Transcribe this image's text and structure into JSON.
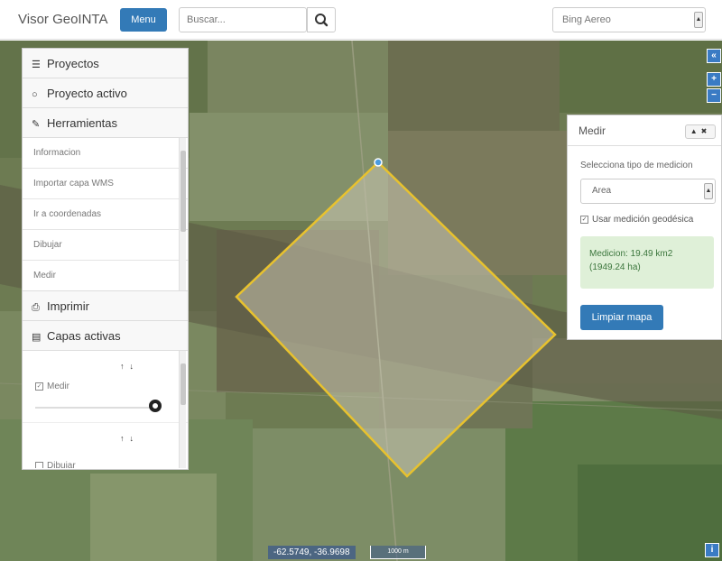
{
  "navbar": {
    "brand": "Visor GeoINTA",
    "menu_label": "Menu",
    "search_placeholder": "Buscar...",
    "basemap_selected": "Bing Aereo"
  },
  "left_panel": {
    "sections": {
      "proyectos": "Proyectos",
      "proyecto_activo": "Proyecto activo",
      "herramientas": "Herramientas",
      "imprimir": "Imprimir",
      "capas_activas": "Capas activas"
    },
    "tools": [
      "Informacion",
      "Importar capa WMS",
      "Ir a coordenadas",
      "Dibujar",
      "Medir"
    ],
    "layers": [
      {
        "name": "Medir",
        "checked": true
      },
      {
        "name": "Dibujar",
        "checked": false
      }
    ]
  },
  "medir_panel": {
    "title": "Medir",
    "type_label": "Selecciona tipo de medicion",
    "type_selected": "Area",
    "geodesic_label": "Usar medición geodésica",
    "geodesic_checked": true,
    "result_line1": "Medicion: 19.49 km2",
    "result_line2": "(1949.24 ha)",
    "clear_label": "Limpiar mapa"
  },
  "map": {
    "coordinates": "-62.5749, -36.9698",
    "scale": "1000 m"
  },
  "colors": {
    "accent": "#337ab7",
    "polygon_stroke": "#e8c22e",
    "result_bg": "#dff0d8"
  },
  "icons": {
    "search": "magnifier",
    "proyectos": "list-icon",
    "proyecto_activo": "circle-icon",
    "herramientas": "wrench-icon",
    "imprimir": "printer-icon",
    "capas_activas": "stack-icon"
  }
}
